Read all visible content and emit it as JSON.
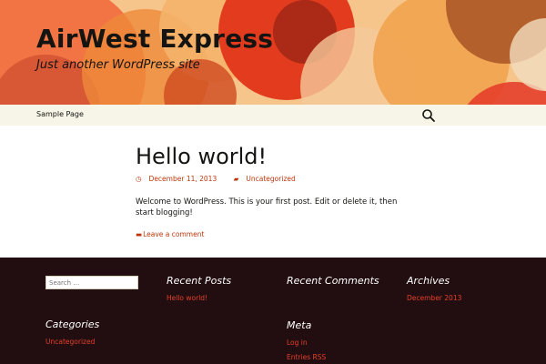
{
  "header": {
    "site_title": "AirWest Express",
    "tagline": "Just another WordPress site"
  },
  "nav": {
    "items": [
      {
        "label": "Sample Page"
      }
    ],
    "search_icon": "search-icon"
  },
  "post": {
    "title": "Hello world!",
    "date": "December 11, 2013",
    "category": "Uncategorized",
    "body": "Welcome to WordPress. This is your first post. Edit or delete it, then start blogging!",
    "comment_link": "Leave a comment"
  },
  "footer": {
    "search_placeholder": "Search …",
    "recent_posts": {
      "title": "Recent Posts",
      "items": [
        "Hello world!"
      ]
    },
    "recent_comments": {
      "title": "Recent Comments"
    },
    "archives": {
      "title": "Archives",
      "items": [
        "December 2013"
      ]
    },
    "categories": {
      "title": "Categories",
      "items": [
        "Uncategorized"
      ]
    },
    "meta": {
      "title": "Meta",
      "items": [
        "Log in",
        "Entries RSS"
      ]
    }
  },
  "colors": {
    "accent": "#bc360a",
    "footer_bg": "#220e10",
    "nav_bg": "#f7f5e7",
    "footer_link": "#e63f2a"
  }
}
